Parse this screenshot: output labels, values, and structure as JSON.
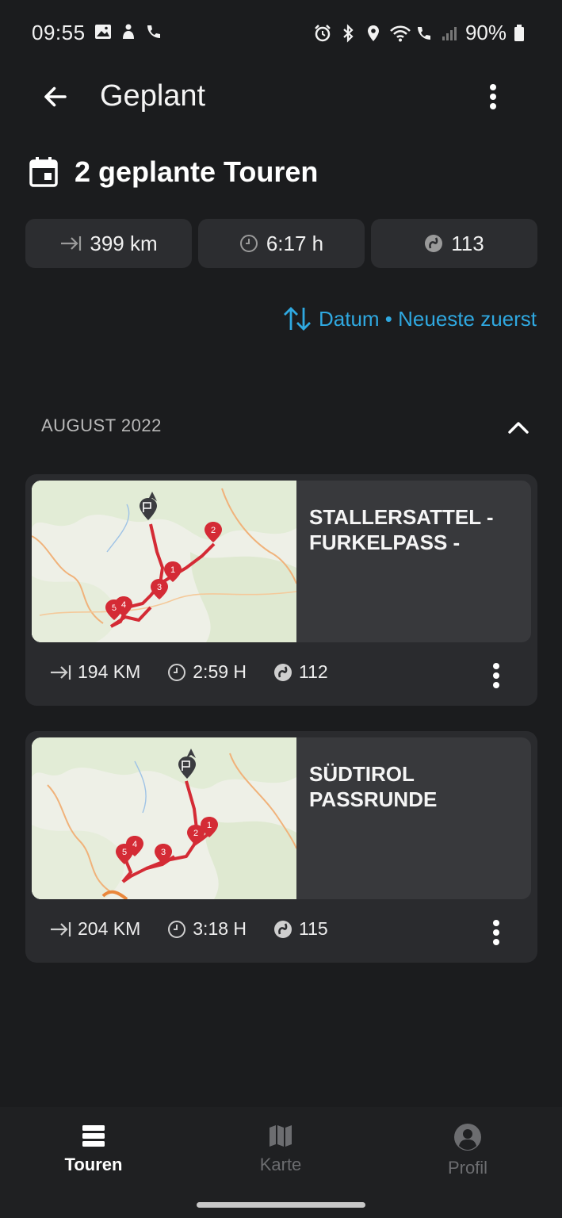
{
  "status_bar": {
    "time": "09:55",
    "battery": "90%",
    "icons_left": [
      "gallery-icon",
      "notification-icon",
      "wifi-call-icon"
    ],
    "icons_right": [
      "alarm-icon",
      "bluetooth-icon",
      "location-icon",
      "wifi-icon",
      "call-icon",
      "signal-icon",
      "battery-icon"
    ]
  },
  "app_bar": {
    "title": "Geplant",
    "back_icon": "arrow-left-icon",
    "more_icon": "more-vertical-icon"
  },
  "heading": {
    "text": "2 geplante Touren",
    "icon": "calendar-icon"
  },
  "summary": {
    "distance": "399 km",
    "duration": "6:17 h",
    "curviness": "113"
  },
  "sort": {
    "label": "Datum • Neueste zuerst",
    "icon": "sort-arrows-icon"
  },
  "section": {
    "title": "AUGUST 2022"
  },
  "tours": [
    {
      "name": "STALLERSATTEL - FURKELPASS -",
      "distance": "194 KM",
      "duration": "2:59 H",
      "curviness": "112",
      "waypoints": [
        "1",
        "2",
        "3",
        "4",
        "5"
      ]
    },
    {
      "name": "SÜDTIROL PASSRUNDE",
      "distance": "204 KM",
      "duration": "3:18 H",
      "curviness": "115",
      "waypoints": [
        "1",
        "2",
        "3",
        "4",
        "5"
      ]
    }
  ],
  "nav": {
    "tours": "Touren",
    "map": "Karte",
    "profile": "Profil"
  },
  "colors": {
    "background": "#1b1c1e",
    "card": "#2a2b2e",
    "accent": "#2fa8e0",
    "route": "#d42b35"
  }
}
